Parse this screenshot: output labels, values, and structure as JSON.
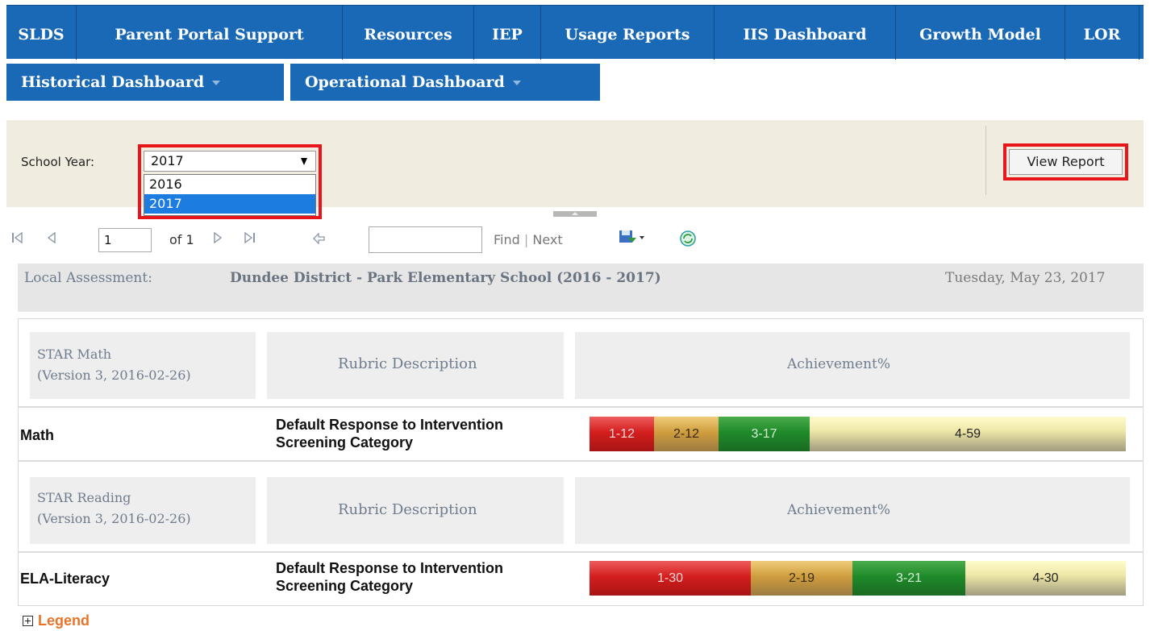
{
  "nav_primary": [
    "SLDS",
    "Parent Portal Support",
    "Resources",
    "IEP",
    "Usage Reports",
    "IIS Dashboard",
    "Growth Model",
    "LOR"
  ],
  "nav_secondary": [
    "Historical Dashboard",
    "Operational Dashboard"
  ],
  "params": {
    "school_year_label": "School Year:",
    "school_year_value": "2017",
    "school_year_options": [
      "2016",
      "2017"
    ],
    "view_report_label": "View Report"
  },
  "toolbar": {
    "page_value": "1",
    "of_label": "of 1",
    "find_label": "Find",
    "separator": "|",
    "next_label": "Next"
  },
  "report": {
    "assessment_label": "Local Assessment:",
    "school_title": "Dundee District - Park Elementary School (2016 - 2017)",
    "date": "Tuesday, May 23, 2017",
    "sections": [
      {
        "assessment_name": "STAR Math",
        "assessment_version": "(Version 3, 2016-02-26)",
        "rubric_header": "Rubric Description",
        "achievement_header": "Achievement%",
        "subject": "Math",
        "rubric_line1": "Default Response to Intervention",
        "rubric_line2": "Screening Category",
        "segments": [
          {
            "label": "1-12",
            "value": 12
          },
          {
            "label": "2-12",
            "value": 12
          },
          {
            "label": "3-17",
            "value": 17
          },
          {
            "label": "4-59",
            "value": 59
          }
        ]
      },
      {
        "assessment_name": "STAR Reading",
        "assessment_version": "(Version 3, 2016-02-26)",
        "rubric_header": "Rubric Description",
        "achievement_header": "Achievement%",
        "subject": "ELA-Literacy",
        "rubric_line1": "Default Response to Intervention",
        "rubric_line2": "Screening Category",
        "segments": [
          {
            "label": "1-30",
            "value": 30
          },
          {
            "label": "2-19",
            "value": 19
          },
          {
            "label": "3-21",
            "value": 21
          },
          {
            "label": "4-30",
            "value": 30
          }
        ]
      }
    ],
    "legend_label": "Legend"
  },
  "icons": [
    "first-page-icon",
    "previous-page-icon",
    "next-page-icon",
    "last-page-icon",
    "back-icon",
    "save-export-icon",
    "refresh-icon",
    "expand-icon"
  ],
  "colors": {
    "nav_bg": "#1a69b6",
    "highlight": "#e8161b",
    "level1": "#d41e1e",
    "level2": "#cf9d3e",
    "level3": "#1f8a2a",
    "level4": "#efe8a8",
    "legend": "#e8742a"
  }
}
